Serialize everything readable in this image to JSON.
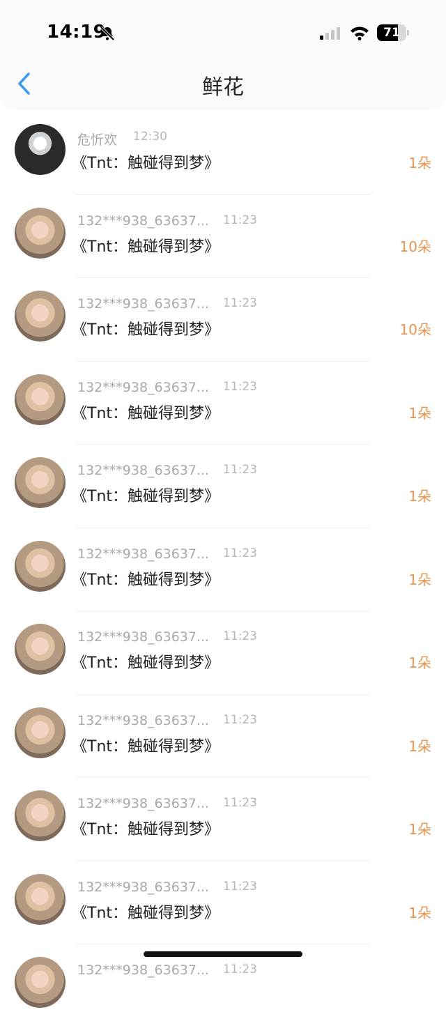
{
  "status_bar": {
    "time": "14:19",
    "battery": "71"
  },
  "header": {
    "title": "鲜花"
  },
  "rows": [
    {
      "avatar": "dark-helmet-avatar",
      "name": "危忻欢",
      "time": "12:30",
      "message": "《Tnt：触碰得到梦》",
      "count": "1朵"
    },
    {
      "avatar": "portrait-avatar",
      "name": "132***938_63637...",
      "time": "11:23",
      "message": "《Tnt：触碰得到梦》",
      "count": "10朵"
    },
    {
      "avatar": "portrait-avatar",
      "name": "132***938_63637...",
      "time": "11:23",
      "message": "《Tnt：触碰得到梦》",
      "count": "10朵"
    },
    {
      "avatar": "portrait-avatar",
      "name": "132***938_63637...",
      "time": "11:23",
      "message": "《Tnt：触碰得到梦》",
      "count": "1朵"
    },
    {
      "avatar": "portrait-avatar",
      "name": "132***938_63637...",
      "time": "11:23",
      "message": "《Tnt：触碰得到梦》",
      "count": "1朵"
    },
    {
      "avatar": "portrait-avatar",
      "name": "132***938_63637...",
      "time": "11:23",
      "message": "《Tnt：触碰得到梦》",
      "count": "1朵"
    },
    {
      "avatar": "portrait-avatar",
      "name": "132***938_63637...",
      "time": "11:23",
      "message": "《Tnt：触碰得到梦》",
      "count": "1朵"
    },
    {
      "avatar": "portrait-avatar",
      "name": "132***938_63637...",
      "time": "11:23",
      "message": "《Tnt：触碰得到梦》",
      "count": "1朵"
    },
    {
      "avatar": "portrait-avatar",
      "name": "132***938_63637...",
      "time": "11:23",
      "message": "《Tnt：触碰得到梦》",
      "count": "1朵"
    },
    {
      "avatar": "portrait-avatar",
      "name": "132***938_63637...",
      "time": "11:23",
      "message": "《Tnt：触碰得到梦》",
      "count": "1朵"
    },
    {
      "avatar": "portrait-avatar",
      "name": "132***938_63637...",
      "time": "11:23",
      "message": "",
      "count": ""
    }
  ],
  "colors": {
    "accent_count": "#e8934e",
    "back_arrow": "#3d9bf0"
  }
}
